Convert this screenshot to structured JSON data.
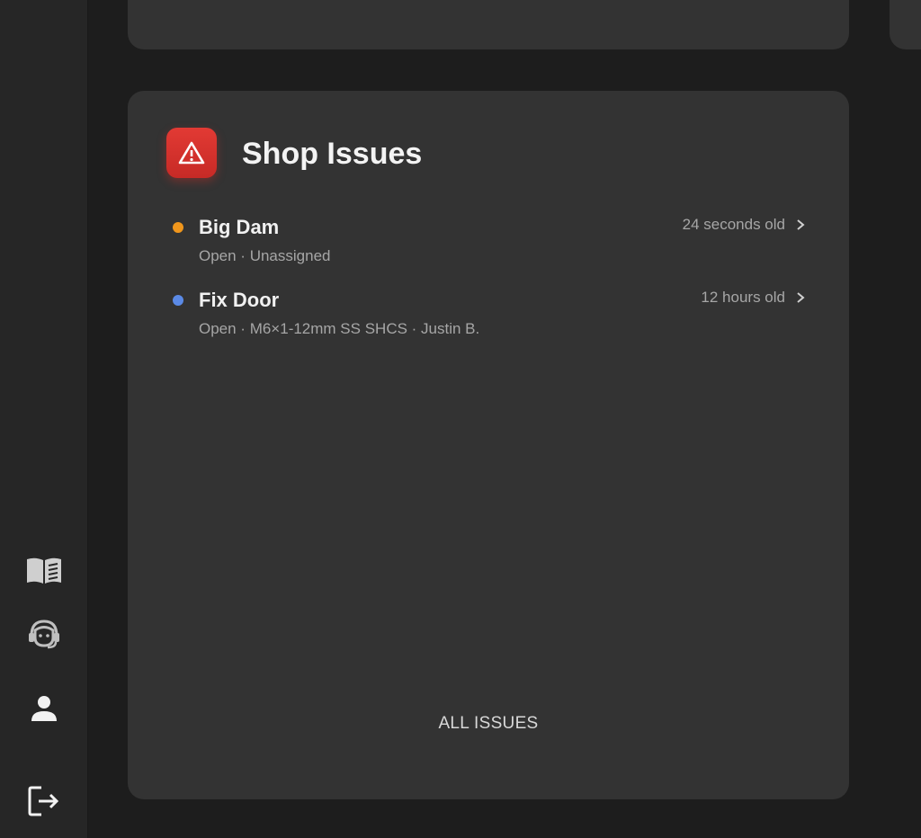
{
  "colors": {
    "accent_red": "#d9322d",
    "dot_orange": "#f0961c",
    "dot_blue": "#5b8ae6"
  },
  "sidebar": {
    "items": [
      {
        "icon": "book-icon"
      },
      {
        "icon": "support-agent-icon"
      },
      {
        "icon": "user-icon"
      },
      {
        "icon": "logout-icon"
      }
    ]
  },
  "issues_card": {
    "icon": "warning-icon",
    "title": "Shop Issues",
    "items": [
      {
        "name": "Big Dam",
        "meta": "Open · Unassigned",
        "age": "24 seconds old",
        "dot_color": "#f0961c"
      },
      {
        "name": "Fix Door",
        "meta": "Open · M6×1-12mm SS SHCS · Justin B.",
        "age": "12 hours old",
        "dot_color": "#5b8ae6"
      }
    ],
    "footer_link": "ALL ISSUES"
  }
}
